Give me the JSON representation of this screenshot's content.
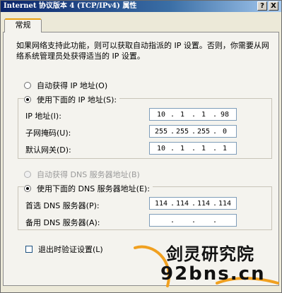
{
  "window": {
    "title": "Internet 协议版本 4 (TCP/IPv4) 属性",
    "help_label": "?",
    "close_label": "X"
  },
  "tab": {
    "label": "常规"
  },
  "description": "如果网络支持此功能，则可以获取自动指派的 IP 设置。否则，你需要从网络系统管理员处获得适当的 IP 设置。",
  "ip": {
    "auto_label": "自动获得 IP 地址(O)",
    "manual_label": "使用下面的 IP 地址(S):",
    "selected": "manual",
    "fields": [
      {
        "label": "IP 地址(I):",
        "octets": [
          "10",
          "1",
          "1",
          "98"
        ]
      },
      {
        "label": "子网掩码(U):",
        "octets": [
          "255",
          "255",
          "255",
          "0"
        ]
      },
      {
        "label": "默认网关(D):",
        "octets": [
          "10",
          "1",
          "1",
          "1"
        ]
      }
    ]
  },
  "dns": {
    "auto_label": "自动获得 DNS 服务器地址(B)",
    "manual_label": "使用下面的 DNS 服务器地址(E):",
    "selected": "manual",
    "fields": [
      {
        "label": "首选 DNS 服务器(P):",
        "octets": [
          "114",
          "114",
          "114",
          "114"
        ]
      },
      {
        "label": "备用 DNS 服务器(A):",
        "octets": [
          "",
          "",
          "",
          ""
        ]
      }
    ]
  },
  "validate_on_exit": {
    "label": "退出时验证设置(L)",
    "checked": false
  },
  "watermark": {
    "line1": "剑灵研究院",
    "line2": "92bns.cn",
    "swoosh_color": "#f0a020"
  }
}
